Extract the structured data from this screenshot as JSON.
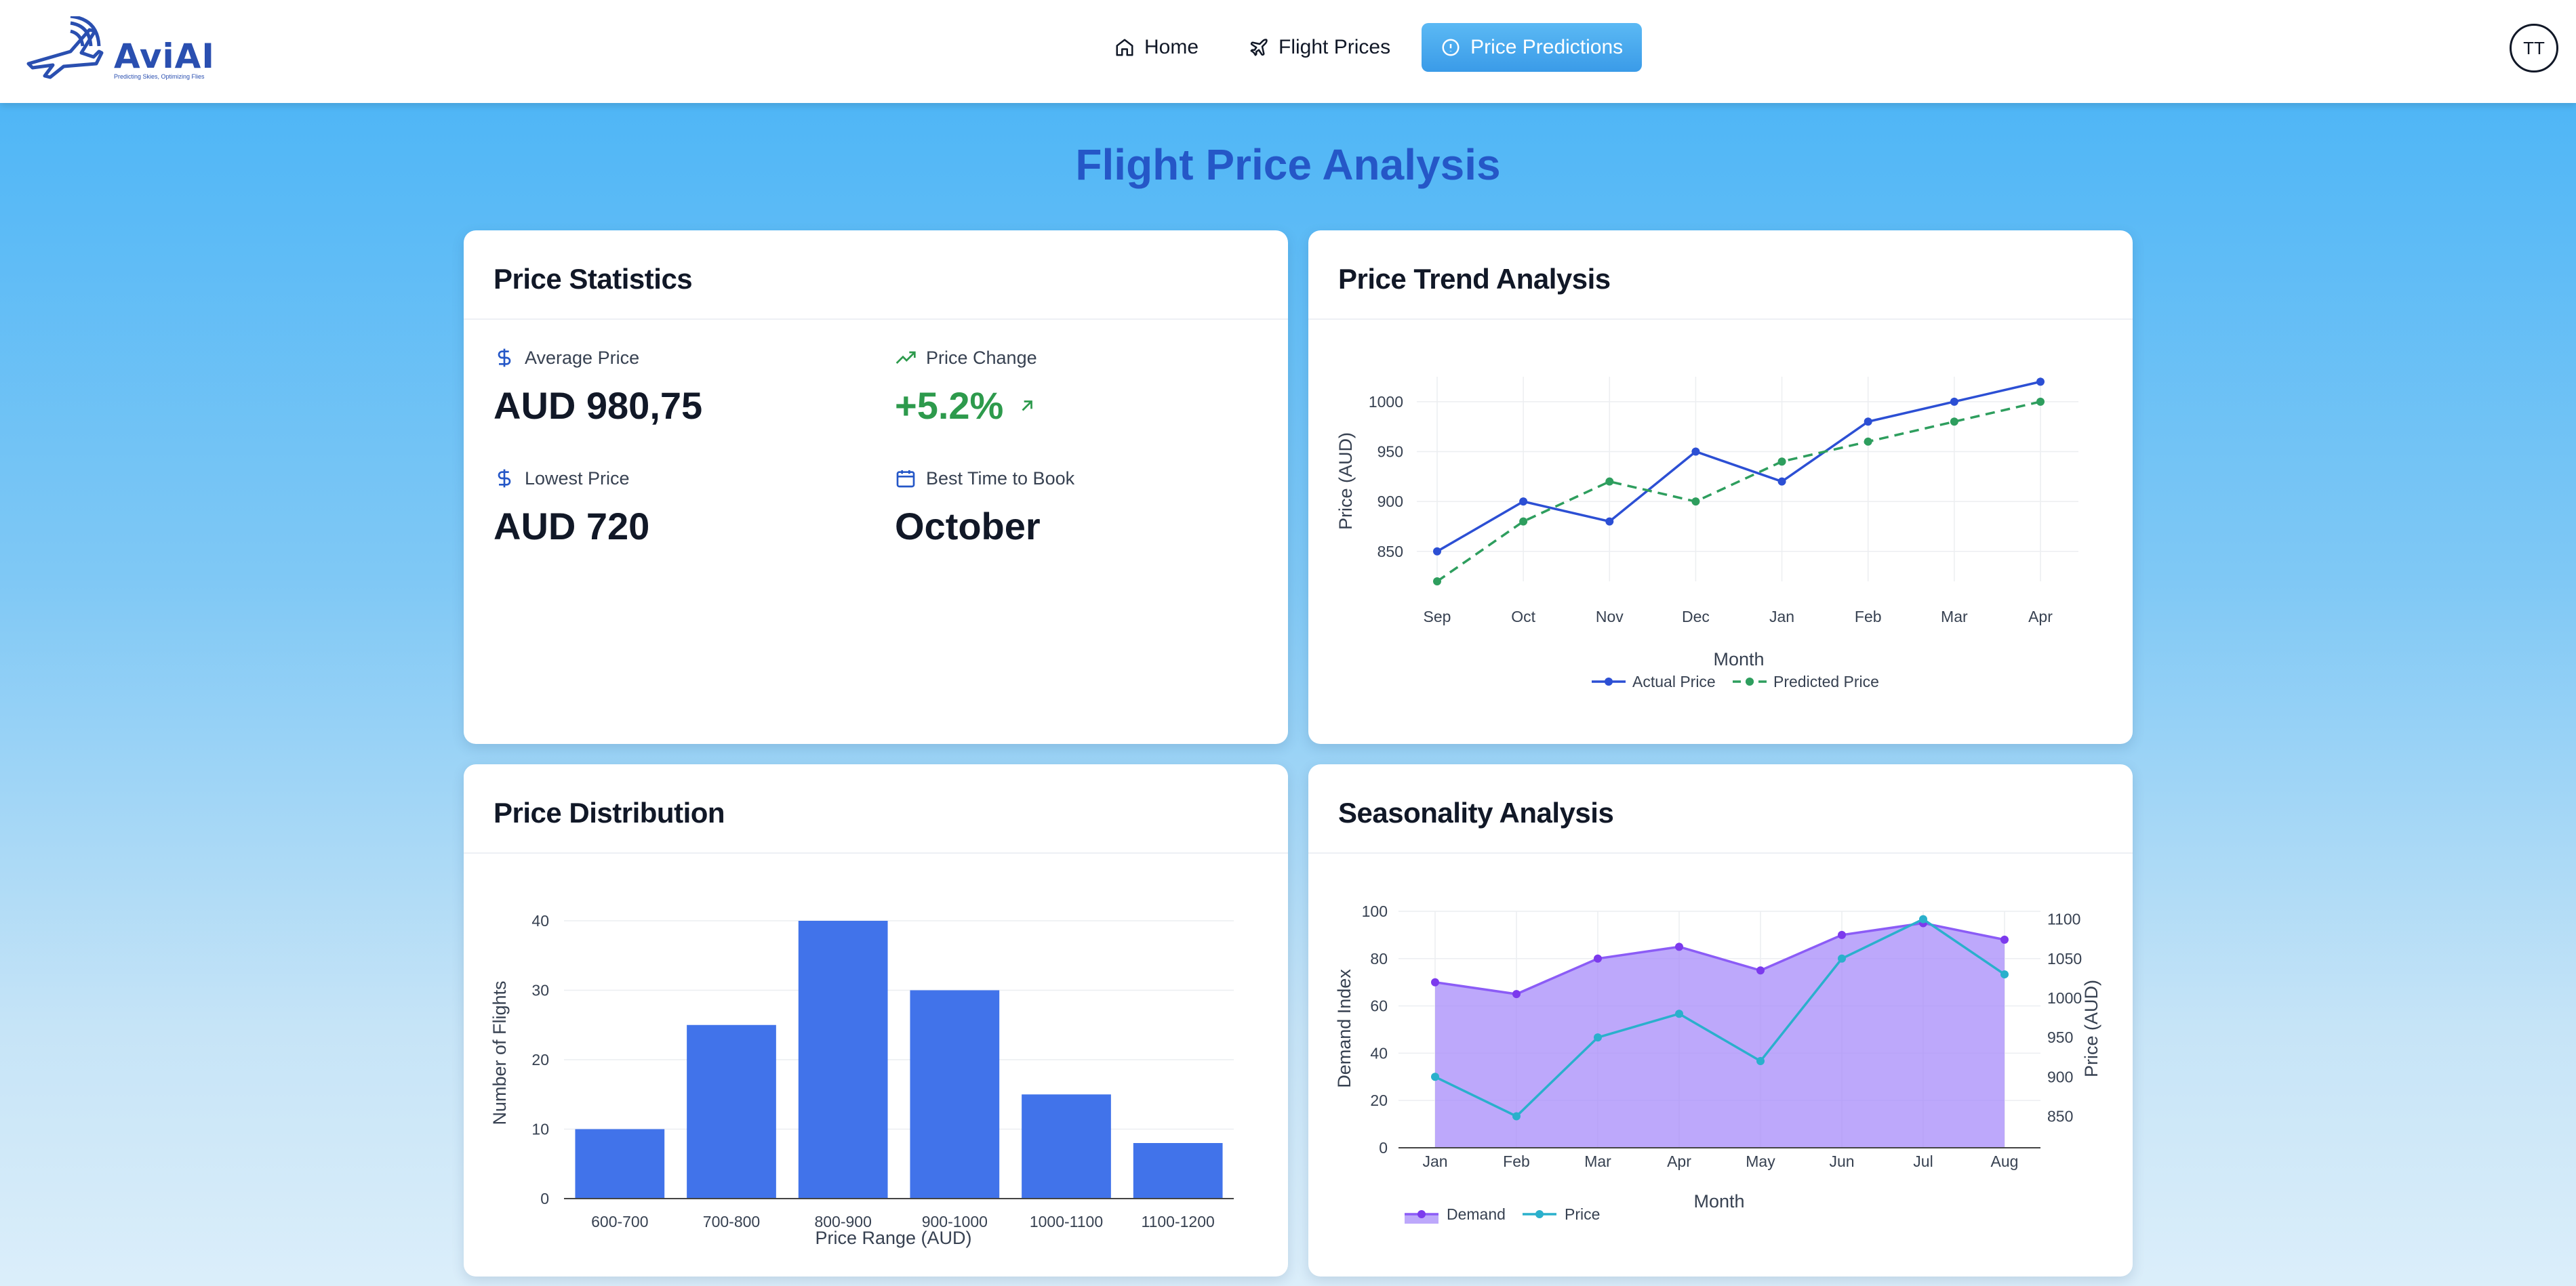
{
  "app": {
    "name": "AviAI",
    "tagline": "Predicting Skies, Optimizing Flies"
  },
  "nav": {
    "items": [
      {
        "label": "Home",
        "icon": "home-icon"
      },
      {
        "label": "Flight Prices",
        "icon": "plane-icon"
      },
      {
        "label": "Price Predictions",
        "icon": "info-circle-icon",
        "active": true
      }
    ]
  },
  "user": {
    "initials": "TT"
  },
  "page": {
    "title": "Flight Price Analysis"
  },
  "colors": {
    "accent": "#2557c7",
    "nav_active": "#3a9be8",
    "actual": "#2c4fd4",
    "predicted": "#2e9e5e",
    "bars": "#4173ea",
    "demand": "#8b5cf6",
    "price_line": "#2ab0cc",
    "positive": "#2d9a4c"
  },
  "stats": {
    "title": "Price Statistics",
    "average": {
      "label": "Average Price",
      "value": "AUD 980,75",
      "icon": "dollar-icon"
    },
    "change": {
      "label": "Price Change",
      "value": "+5.2%",
      "icon": "trending-up-icon"
    },
    "lowest": {
      "label": "Lowest Price",
      "value": "AUD 720",
      "icon": "dollar-icon"
    },
    "best_time": {
      "label": "Best Time to Book",
      "value": "October",
      "icon": "calendar-icon"
    }
  },
  "chart_data": [
    {
      "id": "trend",
      "type": "line",
      "title": "Price Trend Analysis",
      "xlabel": "Month",
      "ylabel": "Price (AUD)",
      "categories": [
        "Sep",
        "Oct",
        "Nov",
        "Dec",
        "Jan",
        "Feb",
        "Mar",
        "Apr"
      ],
      "y_ticks": [
        850,
        900,
        950,
        1000
      ],
      "ylim": [
        820,
        1025
      ],
      "grid": true,
      "legend": "bottom-center",
      "series": [
        {
          "name": "Actual Price",
          "values": [
            850,
            900,
            880,
            950,
            920,
            980,
            1000,
            1020
          ],
          "style": "solid"
        },
        {
          "name": "Predicted Price",
          "values": [
            820,
            880,
            920,
            900,
            940,
            960,
            980,
            1000
          ],
          "style": "dashed"
        }
      ]
    },
    {
      "id": "distribution",
      "type": "bar",
      "title": "Price Distribution",
      "xlabel": "Price Range (AUD)",
      "ylabel": "Number of Flights",
      "categories": [
        "600-700",
        "700-800",
        "800-900",
        "900-1000",
        "1000-1100",
        "1100-1200"
      ],
      "values": [
        10,
        25,
        40,
        30,
        15,
        8
      ],
      "y_ticks": [
        0,
        10,
        20,
        30,
        40
      ],
      "ylim": [
        0,
        40
      ],
      "grid": true
    },
    {
      "id": "seasonality",
      "type": "area",
      "title": "Seasonality Analysis",
      "xlabel": "Month",
      "ylabel": "Demand Index",
      "y2label": "Price (AUD)",
      "categories": [
        "Jan",
        "Feb",
        "Mar",
        "Apr",
        "May",
        "Jun",
        "Jul",
        "Aug"
      ],
      "y_ticks": [
        0,
        20,
        40,
        60,
        80,
        100
      ],
      "ylim": [
        0,
        100
      ],
      "y2_ticks": [
        850,
        900,
        950,
        1000,
        1050,
        1100
      ],
      "y2lim": [
        810,
        1110
      ],
      "grid": true,
      "legend": "bottom-left",
      "series": [
        {
          "name": "Demand",
          "values": [
            70,
            65,
            80,
            85,
            75,
            90,
            95,
            88
          ],
          "axis": "left",
          "style": "area"
        },
        {
          "name": "Price",
          "values": [
            900,
            850,
            950,
            980,
            920,
            1050,
            1100,
            1030
          ],
          "axis": "right",
          "style": "line"
        }
      ]
    }
  ]
}
